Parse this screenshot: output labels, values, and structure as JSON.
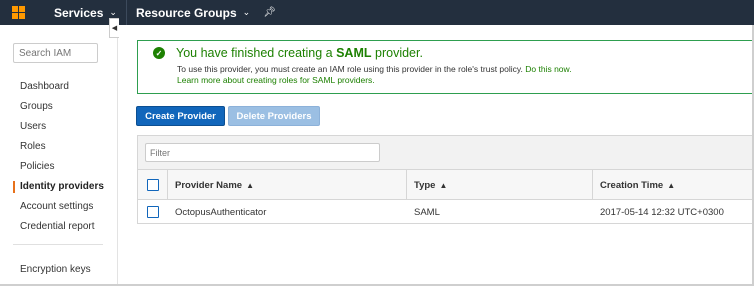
{
  "nav": {
    "services": "Services",
    "resource_groups": "Resource Groups",
    "colors": {
      "bar": "#232f3e",
      "logo": "#ff9900"
    }
  },
  "sidebar": {
    "search_placeholder": "Search IAM",
    "items": [
      {
        "label": "Dashboard"
      },
      {
        "label": "Groups"
      },
      {
        "label": "Users"
      },
      {
        "label": "Roles"
      },
      {
        "label": "Policies"
      },
      {
        "label": "Identity providers",
        "active": true
      },
      {
        "label": "Account settings"
      },
      {
        "label": "Credential report"
      }
    ],
    "encryption_keys": "Encryption keys"
  },
  "alert": {
    "title_prefix": "You have finished creating a",
    "title_bold": "SAML",
    "title_suffix": "provider.",
    "line1_text": "To use this provider, you must create an IAM role using this provider in the role's trust policy.",
    "line1_link": "Do this now.",
    "line2_link": "Learn more about creating roles for SAML providers.",
    "color": "#1d8102"
  },
  "toolbar": {
    "create_label": "Create Provider",
    "delete_label": "Delete Providers"
  },
  "table": {
    "filter_placeholder": "Filter",
    "columns": [
      "Provider Name",
      "Type",
      "Creation Time"
    ],
    "rows": [
      {
        "name": "OctopusAuthenticator",
        "type": "SAML",
        "created": "2017-05-14 12:32 UTC+0300"
      }
    ]
  }
}
